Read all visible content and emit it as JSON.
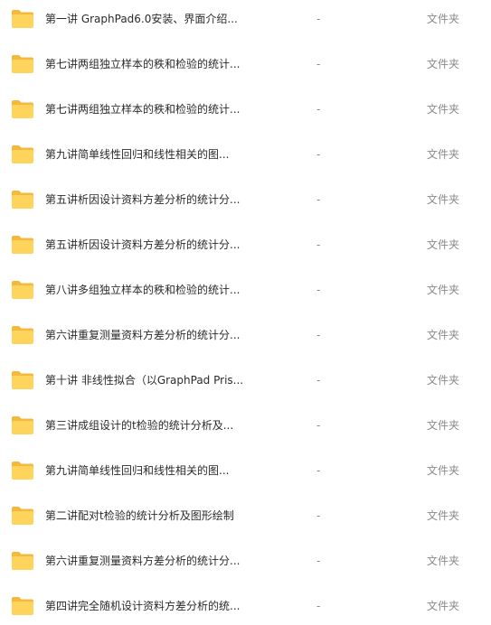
{
  "icon": "folder-icon",
  "colors": {
    "folder_back": "#f4b93a",
    "folder_front": "#ffd45c"
  },
  "files": [
    {
      "name": "第一讲 GraphPad6.0安装、界面介绍...",
      "size": "-",
      "type": "文件夹"
    },
    {
      "name": "第七讲两组独立样本的秩和检验的统计...",
      "size": "-",
      "type": "文件夹"
    },
    {
      "name": "第七讲两组独立样本的秩和检验的统计...",
      "size": "-",
      "type": "文件夹"
    },
    {
      "name": "第九讲简单线性回归和线性相关的图...",
      "size": "-",
      "type": "文件夹"
    },
    {
      "name": "第五讲析因设计资料方差分析的统计分...",
      "size": "-",
      "type": "文件夹"
    },
    {
      "name": "第五讲析因设计资料方差分析的统计分...",
      "size": "-",
      "type": "文件夹"
    },
    {
      "name": "第八讲多组独立样本的秩和检验的统计...",
      "size": "-",
      "type": "文件夹"
    },
    {
      "name": "第六讲重复测量资料方差分析的统计分...",
      "size": "-",
      "type": "文件夹"
    },
    {
      "name": "第十讲 非线性拟合（以GraphPad Pris...",
      "size": "-",
      "type": "文件夹"
    },
    {
      "name": "第三讲成组设计的t检验的统计分析及...",
      "size": "-",
      "type": "文件夹"
    },
    {
      "name": "第九讲简单线性回归和线性相关的图...",
      "size": "-",
      "type": "文件夹"
    },
    {
      "name": "第二讲配对t检验的统计分析及图形绘制",
      "size": "-",
      "type": "文件夹"
    },
    {
      "name": "第六讲重复测量资料方差分析的统计分...",
      "size": "-",
      "type": "文件夹"
    },
    {
      "name": "第四讲完全随机设计资料方差分析的统...",
      "size": "-",
      "type": "文件夹"
    }
  ]
}
